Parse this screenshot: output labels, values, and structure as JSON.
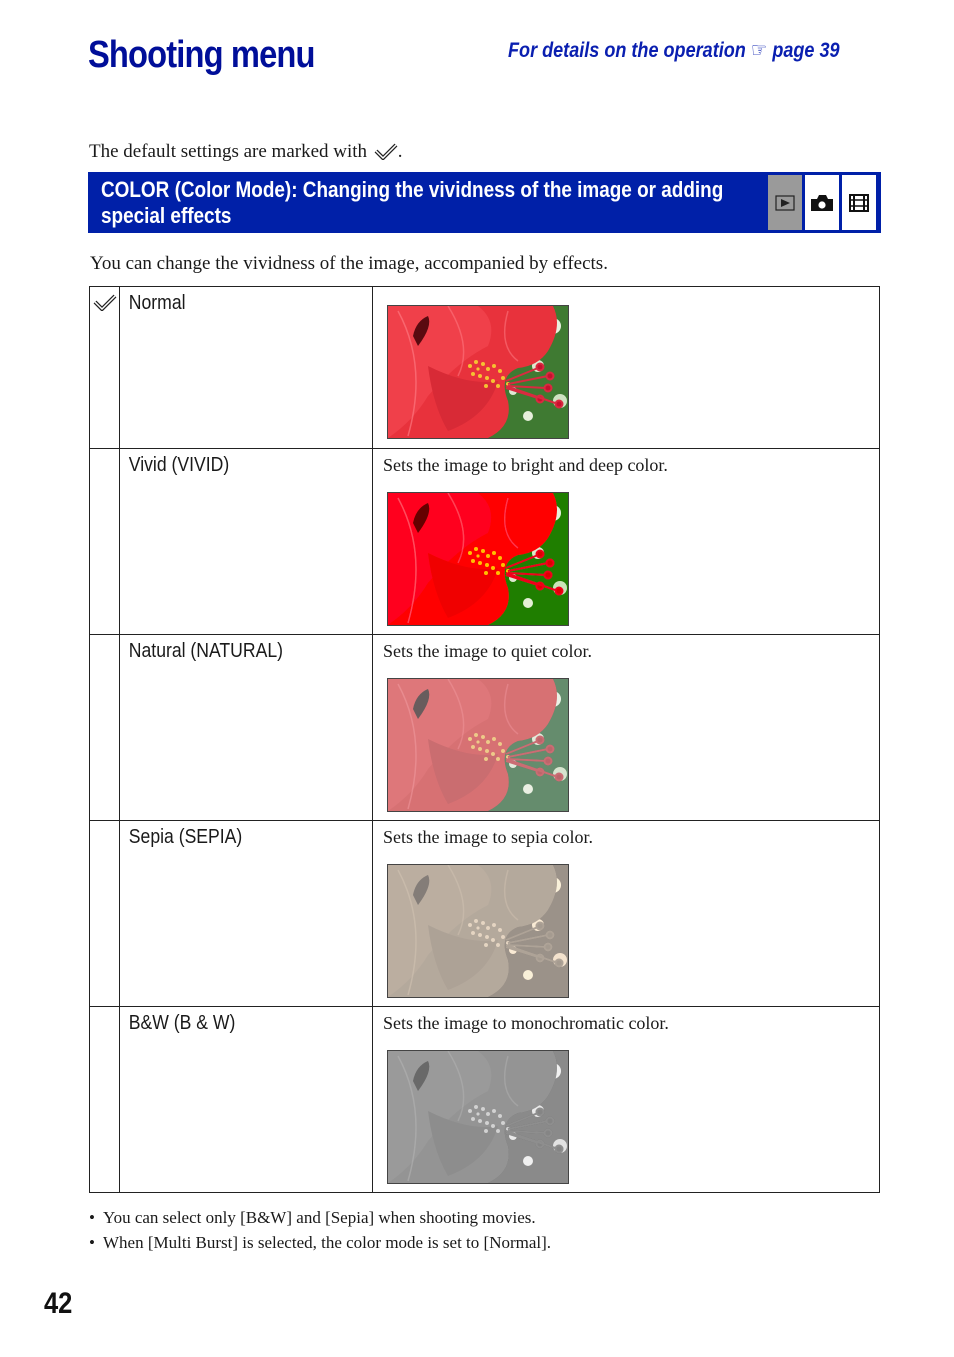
{
  "header": {
    "title": "Shooting menu",
    "xref_prefix": "For details on the operation",
    "xref_icon": "pointing-hand-icon",
    "xref_page": "page 39"
  },
  "intro": {
    "text": "The default settings are marked with",
    "suffix": ".",
    "icon": "default-check-icon"
  },
  "banner": {
    "title_line1": "COLOR (Color Mode): Changing the vividness of the image or adding",
    "title_line2": "special effects",
    "mode_icons": [
      {
        "name": "playback-mode-icon",
        "active": false
      },
      {
        "name": "still-camera-mode-icon",
        "active": true
      },
      {
        "name": "movie-mode-icon",
        "active": true
      }
    ],
    "bg_color": "#0020a8"
  },
  "description": "You can change the vividness of the image, accompanied by effects.",
  "modes": [
    {
      "name": "Normal",
      "description": "",
      "default": true,
      "effect": "normal"
    },
    {
      "name": "Vivid (VIVID)",
      "description": "Sets the image to bright and deep color.",
      "default": false,
      "effect": "vivid"
    },
    {
      "name": "Natural (NATURAL)",
      "description": "Sets the image to quiet color.",
      "default": false,
      "effect": "natural"
    },
    {
      "name": "Sepia (SEPIA)",
      "description": "Sets the image to sepia color.",
      "default": false,
      "effect": "sepia"
    },
    {
      "name": "B&W (B & W)",
      "description": "Sets the image to monochromatic color.",
      "default": false,
      "effect": "bw"
    }
  ],
  "notes": [
    "You can select only [B&W] and [Sepia] when shooting movies.",
    "When [Multi Burst] is selected, the color mode is set to [Normal]."
  ],
  "page_number": "42"
}
